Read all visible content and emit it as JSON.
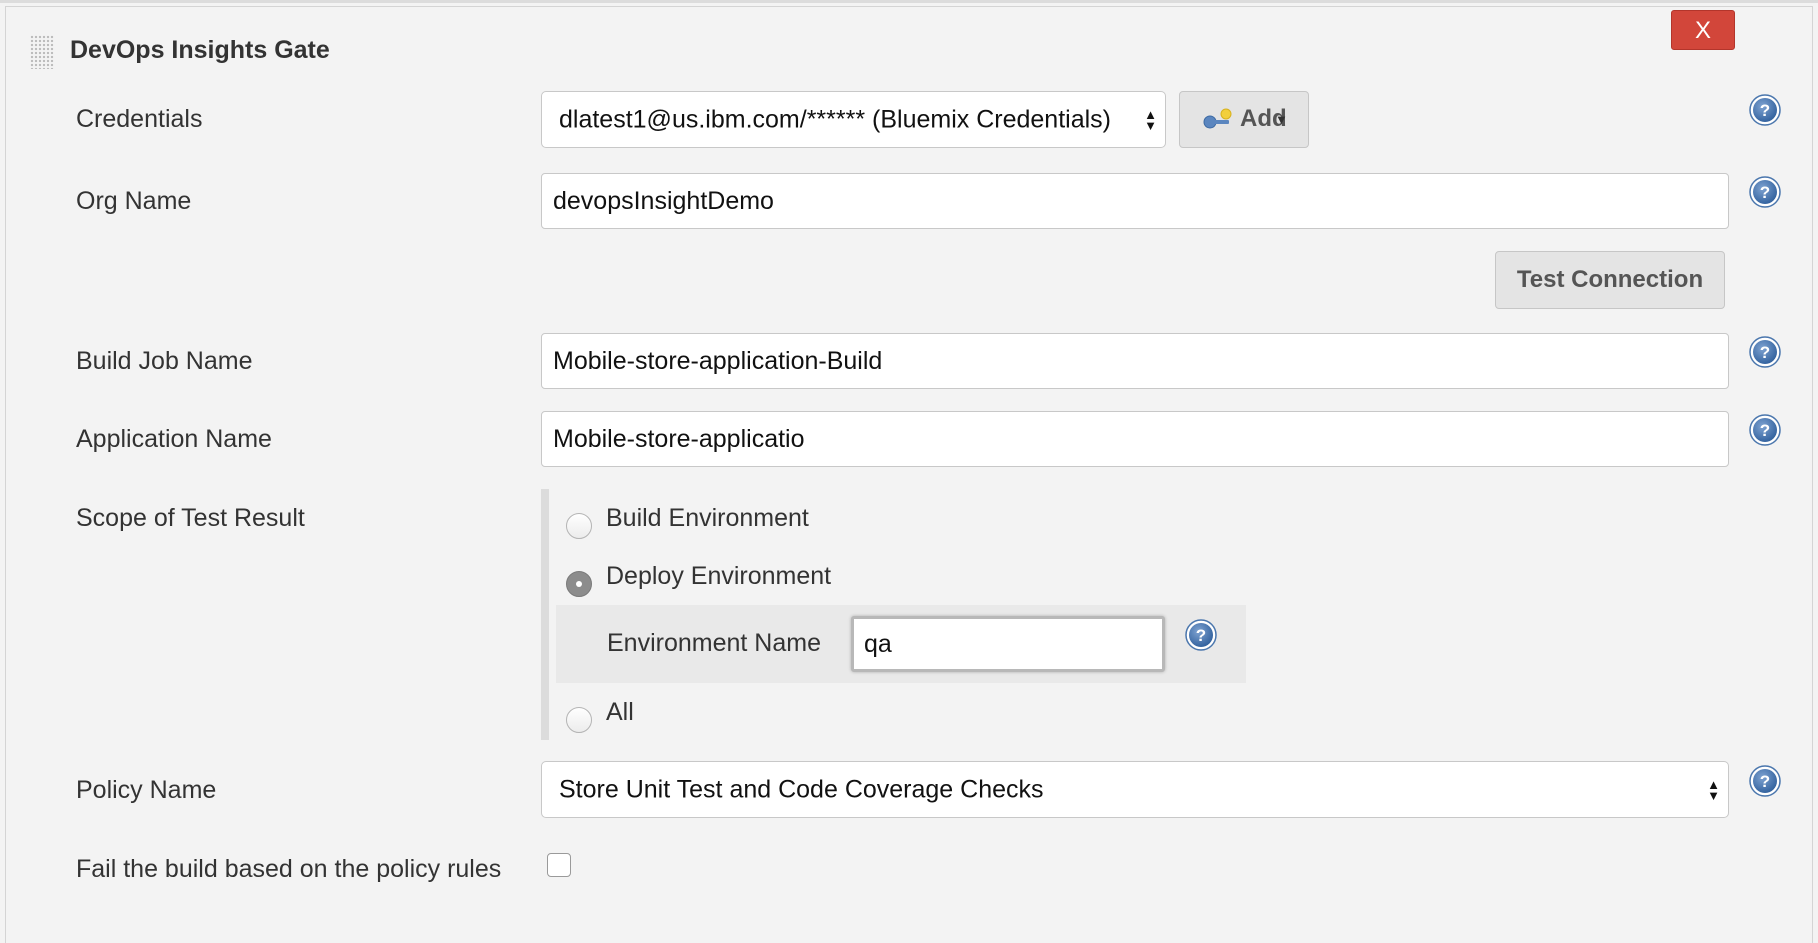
{
  "panel": {
    "title": "DevOps Insights Gate",
    "close_label": "X"
  },
  "icons": {
    "drag": "drag-handle-icon",
    "help": "help-question-icon",
    "key": "key-icon",
    "caret": "caret-down-icon"
  },
  "credentials": {
    "label": "Credentials",
    "selected": "dlatest1@us.ibm.com/****** (Bluemix Credentials)",
    "add_label": "Add"
  },
  "org": {
    "label": "Org Name",
    "value": "devopsInsightDemo"
  },
  "test_connection_label": "Test Connection",
  "build_job": {
    "label": "Build Job Name",
    "value": "Mobile-store-application-Build"
  },
  "application": {
    "label": "Application Name",
    "value": "Mobile-store-applicatio"
  },
  "scope": {
    "label": "Scope of Test Result",
    "options": [
      {
        "label": "Build Environment",
        "checked": false
      },
      {
        "label": "Deploy Environment",
        "checked": true
      },
      {
        "label": "All",
        "checked": false
      }
    ],
    "environment": {
      "label": "Environment Name",
      "value": "qa"
    }
  },
  "policy": {
    "label": "Policy Name",
    "selected": "Store Unit Test and Code Coverage Checks"
  },
  "fail_build": {
    "label": "Fail the build based on the policy rules",
    "checked": false
  },
  "colors": {
    "close_button": "#d2463a",
    "help_icon": "#3f6fa8",
    "background": "#f3f3f3"
  }
}
